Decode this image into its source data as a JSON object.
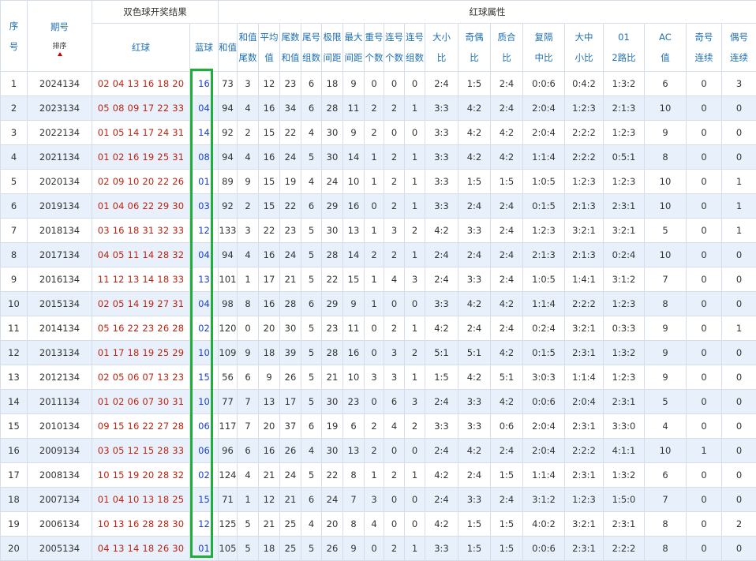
{
  "header": {
    "seq_label": "序号",
    "issue_label": "期号",
    "sort_label": "排序",
    "group_result": "双色球开奖结果",
    "group_attr": "红球属性",
    "red_label": "红球",
    "blue_label": "蓝球",
    "attrs": [
      "和值",
      "和值尾数",
      "平均值",
      "尾数和值",
      "尾号组数",
      "极限间距",
      "最大间距",
      "重号个数",
      "连号个数",
      "连号组数",
      "大小比",
      "奇偶比",
      "质合比",
      "复隔中比",
      "大中小比",
      "012路比",
      "AC值",
      "奇号连续",
      "偶号连续"
    ]
  },
  "rows": [
    {
      "seq": "1",
      "issue": "2024134",
      "red": "02 04 13 16 18 20",
      "blue": "16",
      "a": [
        "73",
        "3",
        "12",
        "23",
        "6",
        "18",
        "9",
        "0",
        "0",
        "0",
        "2:4",
        "1:5",
        "2:4",
        "0:0:6",
        "0:4:2",
        "1:3:2",
        "6",
        "0",
        "3"
      ]
    },
    {
      "seq": "2",
      "issue": "2023134",
      "red": "05 08 09 17 22 33",
      "blue": "04",
      "a": [
        "94",
        "4",
        "16",
        "34",
        "6",
        "28",
        "11",
        "2",
        "2",
        "1",
        "3:3",
        "4:2",
        "2:4",
        "2:0:4",
        "1:2:3",
        "2:1:3",
        "10",
        "0",
        "0"
      ]
    },
    {
      "seq": "3",
      "issue": "2022134",
      "red": "01 05 14 17 24 31",
      "blue": "14",
      "a": [
        "92",
        "2",
        "15",
        "22",
        "4",
        "30",
        "9",
        "2",
        "0",
        "0",
        "3:3",
        "4:2",
        "4:2",
        "2:0:4",
        "2:2:2",
        "1:2:3",
        "9",
        "0",
        "0"
      ]
    },
    {
      "seq": "4",
      "issue": "2021134",
      "red": "01 02 16 19 25 31",
      "blue": "08",
      "a": [
        "94",
        "4",
        "16",
        "24",
        "5",
        "30",
        "14",
        "1",
        "2",
        "1",
        "3:3",
        "4:2",
        "4:2",
        "1:1:4",
        "2:2:2",
        "0:5:1",
        "8",
        "0",
        "0"
      ]
    },
    {
      "seq": "5",
      "issue": "2020134",
      "red": "02 09 10 20 22 26",
      "blue": "01",
      "a": [
        "89",
        "9",
        "15",
        "19",
        "4",
        "24",
        "10",
        "1",
        "2",
        "1",
        "3:3",
        "1:5",
        "1:5",
        "1:0:5",
        "1:2:3",
        "1:2:3",
        "10",
        "0",
        "1"
      ]
    },
    {
      "seq": "6",
      "issue": "2019134",
      "red": "01 04 06 22 29 30",
      "blue": "03",
      "a": [
        "92",
        "2",
        "15",
        "22",
        "6",
        "29",
        "16",
        "0",
        "2",
        "1",
        "3:3",
        "2:4",
        "2:4",
        "0:1:5",
        "2:1:3",
        "2:3:1",
        "10",
        "0",
        "1"
      ]
    },
    {
      "seq": "7",
      "issue": "2018134",
      "red": "03 16 18 31 32 33",
      "blue": "12",
      "a": [
        "133",
        "3",
        "22",
        "23",
        "5",
        "30",
        "13",
        "1",
        "3",
        "2",
        "4:2",
        "3:3",
        "2:4",
        "1:2:3",
        "3:2:1",
        "3:2:1",
        "5",
        "0",
        "1"
      ]
    },
    {
      "seq": "8",
      "issue": "2017134",
      "red": "04 05 11 14 28 32",
      "blue": "04",
      "a": [
        "94",
        "4",
        "16",
        "24",
        "5",
        "28",
        "14",
        "2",
        "2",
        "1",
        "2:4",
        "2:4",
        "2:4",
        "2:1:3",
        "2:1:3",
        "0:2:4",
        "10",
        "0",
        "0"
      ]
    },
    {
      "seq": "9",
      "issue": "2016134",
      "red": "11 12 13 14 18 33",
      "blue": "13",
      "a": [
        "101",
        "1",
        "17",
        "21",
        "5",
        "22",
        "15",
        "1",
        "4",
        "3",
        "2:4",
        "3:3",
        "2:4",
        "1:0:5",
        "1:4:1",
        "3:1:2",
        "7",
        "0",
        "0"
      ]
    },
    {
      "seq": "10",
      "issue": "2015134",
      "red": "02 05 14 19 27 31",
      "blue": "04",
      "a": [
        "98",
        "8",
        "16",
        "28",
        "6",
        "29",
        "9",
        "1",
        "0",
        "0",
        "3:3",
        "4:2",
        "4:2",
        "1:1:4",
        "2:2:2",
        "1:2:3",
        "8",
        "0",
        "0"
      ]
    },
    {
      "seq": "11",
      "issue": "2014134",
      "red": "05 16 22 23 26 28",
      "blue": "02",
      "a": [
        "120",
        "0",
        "20",
        "30",
        "5",
        "23",
        "11",
        "0",
        "2",
        "1",
        "4:2",
        "2:4",
        "2:4",
        "0:2:4",
        "3:2:1",
        "0:3:3",
        "9",
        "0",
        "1"
      ]
    },
    {
      "seq": "12",
      "issue": "2013134",
      "red": "01 17 18 19 25 29",
      "blue": "10",
      "a": [
        "109",
        "9",
        "18",
        "39",
        "5",
        "28",
        "16",
        "0",
        "3",
        "2",
        "5:1",
        "5:1",
        "4:2",
        "0:1:5",
        "2:3:1",
        "1:3:2",
        "9",
        "0",
        "0"
      ]
    },
    {
      "seq": "13",
      "issue": "2012134",
      "red": "02 05 06 07 13 23",
      "blue": "15",
      "a": [
        "56",
        "6",
        "9",
        "26",
        "5",
        "21",
        "10",
        "3",
        "3",
        "1",
        "1:5",
        "4:2",
        "5:1",
        "3:0:3",
        "1:1:4",
        "1:2:3",
        "9",
        "0",
        "0"
      ]
    },
    {
      "seq": "14",
      "issue": "2011134",
      "red": "01 02 06 07 30 31",
      "blue": "10",
      "a": [
        "77",
        "7",
        "13",
        "17",
        "5",
        "30",
        "23",
        "0",
        "6",
        "3",
        "2:4",
        "3:3",
        "4:2",
        "0:0:6",
        "2:0:4",
        "2:3:1",
        "5",
        "0",
        "0"
      ]
    },
    {
      "seq": "15",
      "issue": "2010134",
      "red": "09 15 16 22 27 28",
      "blue": "06",
      "a": [
        "117",
        "7",
        "20",
        "37",
        "6",
        "19",
        "6",
        "2",
        "4",
        "2",
        "3:3",
        "3:3",
        "0:6",
        "2:0:4",
        "2:3:1",
        "3:3:0",
        "4",
        "0",
        "0"
      ]
    },
    {
      "seq": "16",
      "issue": "2009134",
      "red": "03 05 12 15 28 33",
      "blue": "06",
      "a": [
        "96",
        "6",
        "16",
        "26",
        "4",
        "30",
        "13",
        "2",
        "0",
        "0",
        "2:4",
        "4:2",
        "2:4",
        "2:0:4",
        "2:2:2",
        "4:1:1",
        "10",
        "1",
        "0"
      ]
    },
    {
      "seq": "17",
      "issue": "2008134",
      "red": "10 15 19 20 28 32",
      "blue": "02",
      "a": [
        "124",
        "4",
        "21",
        "24",
        "5",
        "22",
        "8",
        "1",
        "2",
        "1",
        "4:2",
        "2:4",
        "1:5",
        "1:1:4",
        "2:3:1",
        "1:3:2",
        "6",
        "0",
        "0"
      ]
    },
    {
      "seq": "18",
      "issue": "2007134",
      "red": "01 04 10 13 18 25",
      "blue": "15",
      "a": [
        "71",
        "1",
        "12",
        "21",
        "6",
        "24",
        "7",
        "3",
        "0",
        "0",
        "2:4",
        "3:3",
        "2:4",
        "3:1:2",
        "1:2:3",
        "1:5:0",
        "7",
        "0",
        "0"
      ]
    },
    {
      "seq": "19",
      "issue": "2006134",
      "red": "10 13 16 28 28 30",
      "blue": "12",
      "a": [
        "125",
        "5",
        "21",
        "25",
        "4",
        "20",
        "8",
        "4",
        "0",
        "0",
        "4:2",
        "1:5",
        "1:5",
        "4:0:2",
        "3:2:1",
        "2:3:1",
        "8",
        "0",
        "2"
      ]
    },
    {
      "seq": "20",
      "issue": "2005134",
      "red": "04 13 14 18 26 30",
      "blue": "01",
      "a": [
        "105",
        "5",
        "18",
        "25",
        "5",
        "26",
        "9",
        "0",
        "2",
        "1",
        "3:3",
        "1:5",
        "1:5",
        "0:0:6",
        "2:3:1",
        "2:2:2",
        "8",
        "0",
        "0"
      ]
    }
  ]
}
